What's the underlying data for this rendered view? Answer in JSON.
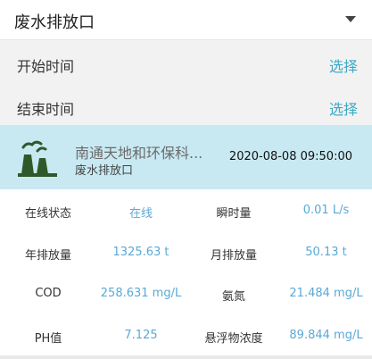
{
  "selector": {
    "value": "废水排放口"
  },
  "time_filters": [
    {
      "label": "开始时间",
      "action": "选择"
    },
    {
      "label": "结束时间",
      "action": "选择"
    }
  ],
  "station": {
    "name": "南通天地和环保科...",
    "type": "废水排放口",
    "timestamp": "2020-08-08 09:50:00",
    "icon": "factory-icon"
  },
  "metrics": [
    {
      "label": "在线状态",
      "value": "在线",
      "label2": "瞬时量",
      "value2": "0.01 L/s"
    },
    {
      "label": "年排放量",
      "value": "1325.63 t",
      "label2": "月排放量",
      "value2": "50.13 t"
    },
    {
      "label": "COD",
      "value": "258.631 mg/L",
      "label2": "氨氮",
      "value2": "21.484 mg/L"
    },
    {
      "label": "PH值",
      "value": "7.125",
      "label2": "悬浮物浓度",
      "value2": "89.844 mg/L"
    }
  ],
  "colors": {
    "accent": "#3aa9c4",
    "value_text": "#5aa9d6",
    "station_bg": "#c8e9f2",
    "icon_green": "#2e5a2a"
  }
}
